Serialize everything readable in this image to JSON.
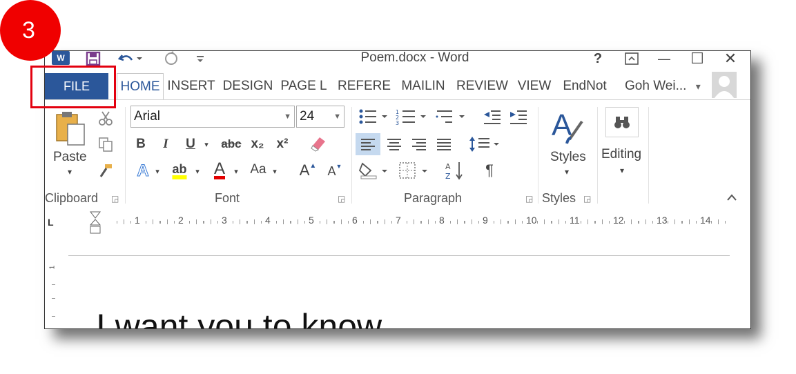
{
  "step_badge": "3",
  "window": {
    "title": "Poem.docx - Word",
    "app_icon_letter": "W",
    "help": "?",
    "restore_ribbon": "⊼",
    "minimize": "—",
    "maximize": "☐",
    "close": "✕"
  },
  "tabs": {
    "file": "FILE",
    "items": [
      "HOME",
      "INSERT",
      "DESIGN",
      "PAGE L",
      "REFERE",
      "MAILIN",
      "REVIEW",
      "VIEW",
      "EndNot"
    ],
    "selected": "HOME",
    "user": "Goh Wei...",
    "user_dropdown": "▾"
  },
  "ribbon": {
    "clipboard": {
      "label": "Clipboard",
      "paste": "Paste",
      "paste_dropdown": "▾"
    },
    "font": {
      "label": "Font",
      "font_name": "Arial",
      "font_size": "24",
      "bold": "B",
      "italic": "I",
      "underline": "U",
      "strikethrough": "abc",
      "subscript": "x₂",
      "superscript": "x²",
      "text_effects": "A",
      "highlight": "ab",
      "font_color": "A",
      "change_case": "Aa",
      "grow": "A",
      "shrink": "A"
    },
    "paragraph": {
      "label": "Paragraph",
      "show_marks": "¶"
    },
    "styles": {
      "label": "Styles",
      "button": "Styles"
    },
    "editing": {
      "button": "Editing"
    }
  },
  "ruler": {
    "marks": [
      "1",
      "2",
      "3",
      "4",
      "5",
      "6",
      "7",
      "8",
      "9",
      "10",
      "11",
      "12",
      "13",
      "14"
    ],
    "tab_selector": "L",
    "vertical_mark": "1"
  },
  "document": {
    "text": "I want you to know"
  },
  "colors": {
    "file_tab": "#2b579a",
    "badge": "#f00000",
    "highlight_box": "#e3000f",
    "selected_align": "#c5d9ef"
  }
}
